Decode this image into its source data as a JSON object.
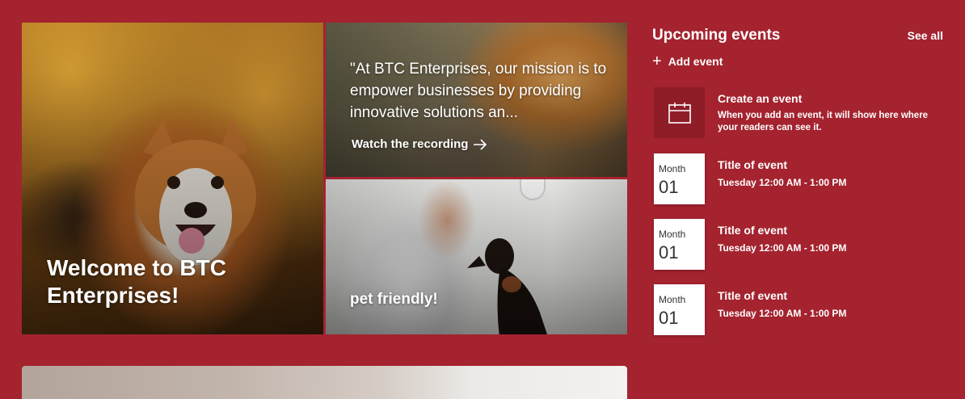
{
  "hero": {
    "main_tile": {
      "title": "Welcome to BTC Enterprises!"
    },
    "quote_tile": {
      "text": "\"At BTC Enterprises, our mission is to empower businesses by providing innovative solutions an...",
      "link_label": "Watch the recording"
    },
    "pet_tile": {
      "title": "pet friendly!"
    }
  },
  "events": {
    "title": "Upcoming events",
    "see_all": "See all",
    "add_event": "Add event",
    "create": {
      "title": "Create an event",
      "description": "When you add an event, it will show here where your readers can see it."
    },
    "items": [
      {
        "month": "Month",
        "day": "01",
        "title": "Title of event",
        "time": "Tuesday 12:00 AM - 1:00 PM"
      },
      {
        "month": "Month",
        "day": "01",
        "title": "Title of event",
        "time": "Tuesday 12:00 AM - 1:00 PM"
      },
      {
        "month": "Month",
        "day": "01",
        "title": "Title of event",
        "time": "Tuesday 12:00 AM - 1:00 PM"
      }
    ]
  },
  "colors": {
    "background": "#a4232f",
    "calendar_box": "#8f1d28",
    "text": "#ffffff"
  },
  "icons": {
    "add": "plus-icon",
    "calendar": "calendar-icon",
    "arrow": "arrow-right-icon"
  }
}
